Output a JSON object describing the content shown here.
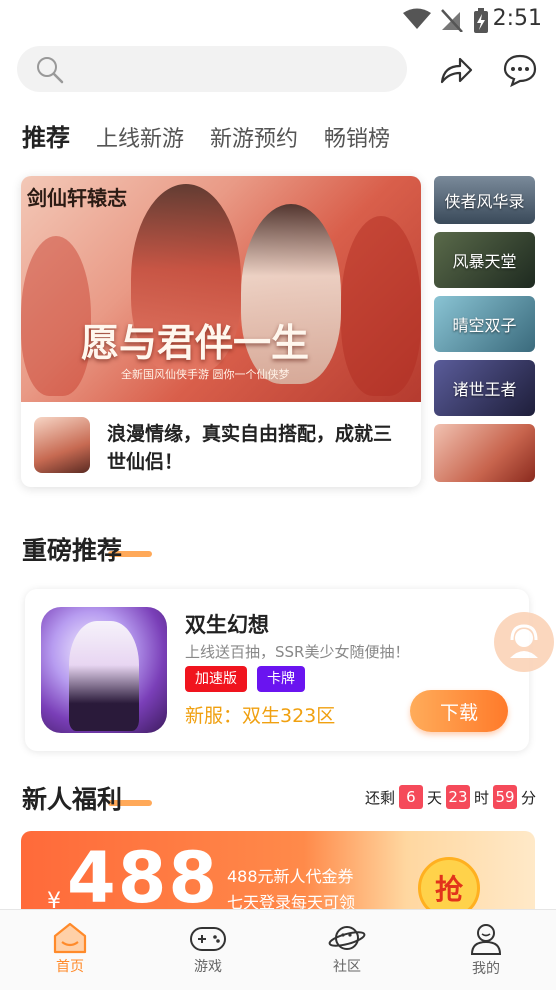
{
  "status_bar": {
    "time": "2:51"
  },
  "search": {
    "placeholder": ""
  },
  "tabs": [
    {
      "label": "推荐"
    },
    {
      "label": "上线新游"
    },
    {
      "label": "新游预约"
    },
    {
      "label": "畅销榜"
    }
  ],
  "banner": {
    "logo_text": "剑仙轩辕志",
    "slogan": "愿与君伴一生",
    "subtitle": "全新国风仙侠手游 圆你一个仙侠梦",
    "caption": "浪漫情缘，真实自由搭配，成就三世仙侣！"
  },
  "side_list": [
    {
      "label": "侠者风华录",
      "color": "#5a6a7a"
    },
    {
      "label": "风暴天堂",
      "color": "#3a4a3c"
    },
    {
      "label": "晴空双子",
      "color": "#5a8a9c"
    },
    {
      "label": "诸世王者",
      "color": "#3a3c6a"
    },
    {
      "label": "",
      "color": "#c8654e"
    }
  ],
  "featured": {
    "title": "重磅推荐",
    "game_name": "双生幻想",
    "description": "上线送百抽，SSR美少女随便抽！",
    "tags": [
      {
        "label": "加速版",
        "color": "#f0141e"
      },
      {
        "label": "卡牌",
        "color": "#6a14f0"
      }
    ],
    "server": "新服：双生323区",
    "download_label": "下载"
  },
  "welfare": {
    "title": "新人福利",
    "countdown": {
      "prefix": "还剩",
      "days": "6",
      "day_unit": "天",
      "hours": "23",
      "hour_unit": "时",
      "minutes": "59",
      "minute_unit": "分"
    },
    "currency": "¥",
    "amount": "488",
    "line1": "488元新人代金券",
    "line2": "七天登录每天可领",
    "grab_label": "抢"
  },
  "nav": [
    {
      "label": "首页",
      "icon": "home-icon",
      "active": true
    },
    {
      "label": "游戏",
      "icon": "gamepad-icon",
      "active": false
    },
    {
      "label": "社区",
      "icon": "planet-icon",
      "active": false
    },
    {
      "label": "我的",
      "icon": "profile-icon",
      "active": false
    }
  ],
  "colors": {
    "accent": "#ff8a2a",
    "countdown_bg": "#f54a5a"
  }
}
